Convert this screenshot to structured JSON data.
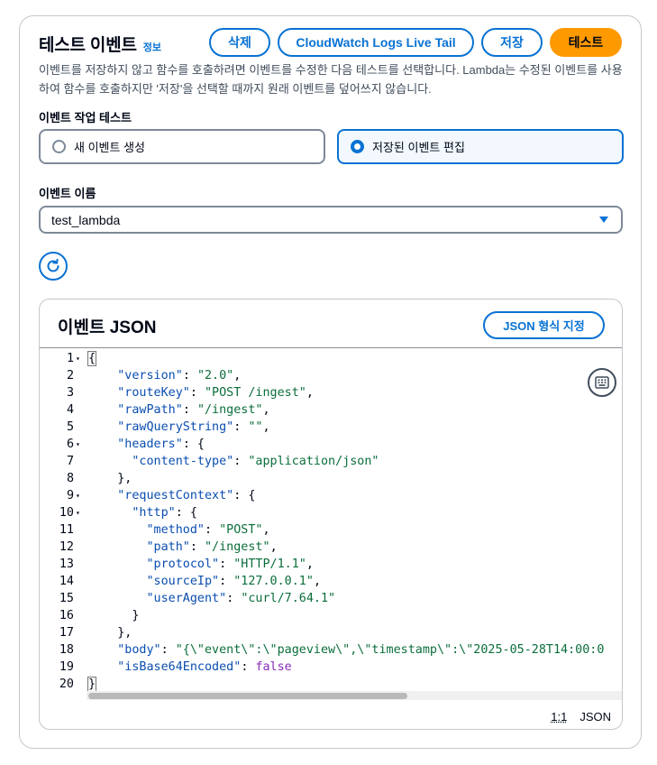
{
  "header": {
    "title": "테스트 이벤트",
    "info_link": "정보",
    "buttons": {
      "delete": "삭제",
      "live_tail": "CloudWatch Logs Live Tail",
      "save": "저장",
      "test": "테스트"
    },
    "description": "이벤트를 저장하지 않고 함수를 호출하려면 이벤트를 수정한 다음 테스트를 선택합니다. Lambda는 수정된 이벤트를 사용하여 함수를 호출하지만 '저장'을 선택할 때까지 원래 이벤트를 덮어쓰지 않습니다."
  },
  "event_action": {
    "label": "이벤트 작업 테스트",
    "options": [
      {
        "label": "새 이벤트 생성",
        "selected": false
      },
      {
        "label": "저장된 이벤트 편집",
        "selected": true
      }
    ]
  },
  "event_name": {
    "label": "이벤트 이름",
    "value": "test_lambda"
  },
  "json_panel": {
    "title": "이벤트 JSON",
    "format_button": "JSON 형식 지정",
    "status_position": "1:1",
    "status_mode": "JSON",
    "lines": [
      {
        "n": "1",
        "fold": true,
        "text": "{"
      },
      {
        "n": "2",
        "fold": false,
        "text": "    \"version\": \"2.0\","
      },
      {
        "n": "3",
        "fold": false,
        "text": "    \"routeKey\": \"POST /ingest\","
      },
      {
        "n": "4",
        "fold": false,
        "text": "    \"rawPath\": \"/ingest\","
      },
      {
        "n": "5",
        "fold": false,
        "text": "    \"rawQueryString\": \"\","
      },
      {
        "n": "6",
        "fold": true,
        "text": "    \"headers\": {"
      },
      {
        "n": "7",
        "fold": false,
        "text": "      \"content-type\": \"application/json\""
      },
      {
        "n": "8",
        "fold": false,
        "text": "    },"
      },
      {
        "n": "9",
        "fold": true,
        "text": "    \"requestContext\": {"
      },
      {
        "n": "10",
        "fold": true,
        "text": "      \"http\": {"
      },
      {
        "n": "11",
        "fold": false,
        "text": "        \"method\": \"POST\","
      },
      {
        "n": "12",
        "fold": false,
        "text": "        \"path\": \"/ingest\","
      },
      {
        "n": "13",
        "fold": false,
        "text": "        \"protocol\": \"HTTP/1.1\","
      },
      {
        "n": "14",
        "fold": false,
        "text": "        \"sourceIp\": \"127.0.0.1\","
      },
      {
        "n": "15",
        "fold": false,
        "text": "        \"userAgent\": \"curl/7.64.1\""
      },
      {
        "n": "16",
        "fold": false,
        "text": "      }"
      },
      {
        "n": "17",
        "fold": false,
        "text": "    },"
      },
      {
        "n": "18",
        "fold": false,
        "text": "    \"body\": \"{\\\"event\\\":\\\"pageview\\\",\\\"timestamp\\\":\\\"2025-05-28T14:00:0"
      },
      {
        "n": "19",
        "fold": false,
        "text": "    \"isBase64Encoded\": false"
      },
      {
        "n": "20",
        "fold": false,
        "text": "}"
      }
    ]
  },
  "colors": {
    "accent": "#0972d3",
    "primary_button": "#ff9900",
    "json_key": "#0b4eb0",
    "json_string": "#0b6e3b",
    "json_boolean": "#8a2bb8"
  }
}
